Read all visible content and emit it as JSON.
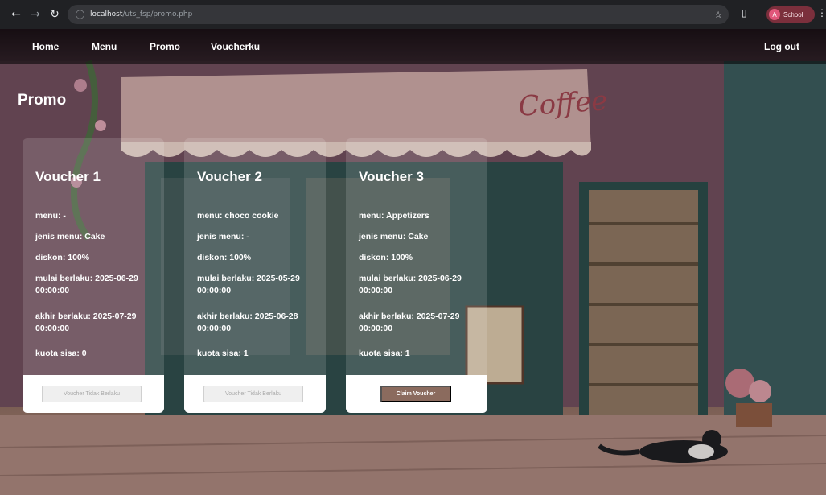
{
  "browser": {
    "url_host": "localhost",
    "url_path": "/uts_fsp/promo.php",
    "profile_initial": "A",
    "profile_label": "School"
  },
  "colors": {
    "navbar_bg": "#000000",
    "card_footer": "#ffffff",
    "claim_button": "#8b6b5e",
    "profile_chip": "#7b2f3c"
  },
  "icons": [
    "back-icon",
    "forward-icon",
    "reload-icon",
    "site-info-icon",
    "star-icon",
    "extensions-icon",
    "menu-dots-icon"
  ],
  "nav": {
    "home": "Home",
    "menu": "Menu",
    "promo": "Promo",
    "voucherku": "Voucherku",
    "logout": "Log out"
  },
  "page": {
    "title": "Promo"
  },
  "vouchers": [
    {
      "title": "Voucher 1",
      "menu": "menu: -",
      "jenis_menu": "jenis menu: Cake",
      "diskon": "diskon: 100%",
      "mulai": "mulai berlaku: 2025-06-29 00:00:00",
      "akhir": "akhir berlaku: 2025-07-29 00:00:00",
      "kuota": "kuota sisa: 0",
      "button": "Voucher Tidak Berlaku",
      "button_enabled": false
    },
    {
      "title": "Voucher 2",
      "menu": "menu: choco cookie",
      "jenis_menu": "jenis menu: -",
      "diskon": "diskon: 100%",
      "mulai": "mulai berlaku: 2025-05-29 00:00:00",
      "akhir": "akhir berlaku: 2025-06-28 00:00:00",
      "kuota": "kuota sisa: 1",
      "button": "Voucher Tidak Berlaku",
      "button_enabled": false
    },
    {
      "title": "Voucher 3",
      "menu": "menu: Appetizers",
      "jenis_menu": "jenis menu: Cake",
      "diskon": "diskon: 100%",
      "mulai": "mulai berlaku: 2025-06-29 00:00:00",
      "akhir": "akhir berlaku: 2025-07-29 00:00:00",
      "kuota": "kuota sisa: 1",
      "button": "Claim Voucher",
      "button_enabled": true
    }
  ]
}
